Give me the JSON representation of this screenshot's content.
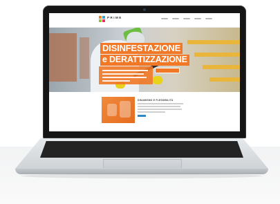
{
  "site": {
    "logo_text": "PRIME",
    "hero": {
      "title_line1": "DISINFESTAZIONE",
      "title_line2": "e DERATTIZZAZIONE"
    },
    "section": {
      "heading": "DINAMISMO E FLESSIBILITÀ"
    }
  },
  "colors": {
    "accent": "#f07826",
    "button_blue": "#2e88c8",
    "laptop_bezel": "#151515"
  }
}
